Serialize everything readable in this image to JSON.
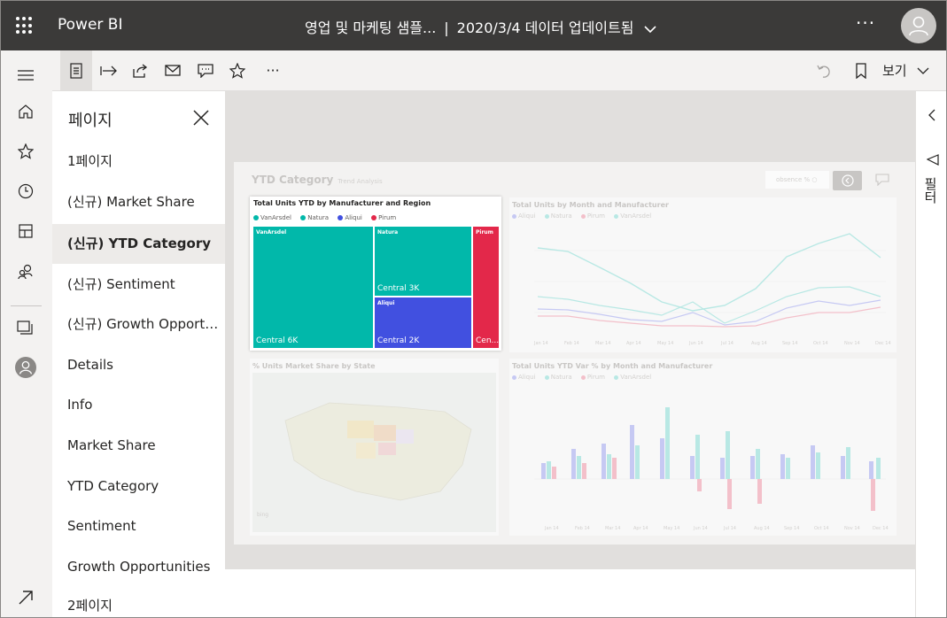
{
  "header": {
    "app_name": "Power BI",
    "report_title": "영업 및 마케팅 샘플...",
    "separator": "|",
    "updated": "2020/3/4 데이터 업데이트됨",
    "more": "···"
  },
  "actionbar": {
    "more": "···",
    "view_label": "보기"
  },
  "pages_pane": {
    "title": "페이지",
    "items": [
      {
        "label": "1페이지"
      },
      {
        "label": "(신규) Market Share"
      },
      {
        "label": "(신규) YTD Category"
      },
      {
        "label": "(신규) Sentiment"
      },
      {
        "label": "(신규) Growth Opportunities"
      },
      {
        "label": "Details"
      },
      {
        "label": "Info"
      },
      {
        "label": "Market Share"
      },
      {
        "label": "YTD Category"
      },
      {
        "label": "Sentiment"
      },
      {
        "label": "Growth Opportunities"
      },
      {
        "label": "2페이지"
      }
    ],
    "active_index": 2
  },
  "report": {
    "title": "YTD Category",
    "subtitle": "Trend Analysis",
    "slicer_text": "obsence % ○",
    "visuals": {
      "treemap": {
        "title": "Total Units YTD by Manufacturer and Region",
        "legend": [
          "VanArsdel",
          "Natura",
          "Aliqui",
          "Pirum"
        ],
        "blocks": {
          "vanarsdel": {
            "category": "VanArsdel",
            "region": "Central 6K"
          },
          "natura": {
            "category": "Natura",
            "region": "Central 3K"
          },
          "aliqui": {
            "category": "Aliqui",
            "region": "Central 2K"
          },
          "pirum": {
            "category": "Pirum",
            "region": "Cen..."
          }
        }
      },
      "line_chart": {
        "title": "Total Units by Month and Manufacturer",
        "legend": [
          "Aliqui",
          "Natura",
          "Pirum",
          "VanArsdel"
        ]
      },
      "map": {
        "title": "% Units Market Share by State",
        "bing": "bing"
      },
      "bar_chart": {
        "title": "Total Units YTD Var % by Month and Manufacturer",
        "legend": [
          "Aliqui",
          "Natura",
          "Pirum",
          "VanArsdel"
        ]
      }
    }
  },
  "filter_pane": {
    "label": "필터"
  },
  "colors": {
    "vanarsdel": "#01b8aa",
    "natura": "#01b8aa",
    "aliqui": "#4150e0",
    "pirum": "#e3284a",
    "header": "#3b3a39"
  }
}
